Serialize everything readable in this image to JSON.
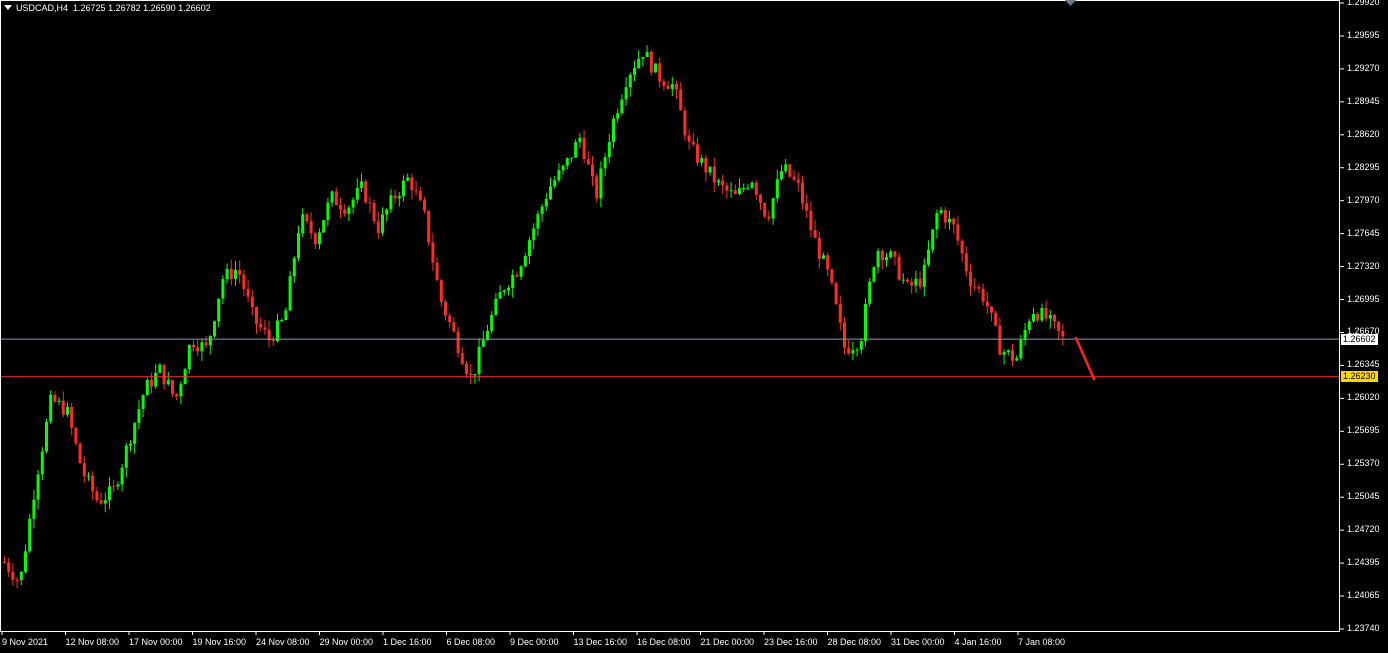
{
  "header": {
    "symbol_label": "USDCAD,H4",
    "ohlc_text": "1.26725 1.26782 1.26590 1.26602"
  },
  "colors": {
    "background": "#000000",
    "bull": "#00ff00",
    "bear": "#ff2a2a",
    "frame": "#ffffff",
    "current_price_line": "#8a9cb0",
    "support_line": "#ff3030",
    "support_tag": "#ffd700",
    "arrow": "#ff2020"
  },
  "chart_data": {
    "type": "candlestick",
    "title": "USDCAD,H4",
    "ylim": [
      1.2374,
      1.2992
    ],
    "y_ticks": [
      "1.29920",
      "1.29595",
      "1.29270",
      "1.28945",
      "1.28620",
      "1.28295",
      "1.27970",
      "1.27645",
      "1.27320",
      "1.26995",
      "1.26670",
      "1.26345",
      "1.26020",
      "1.25695",
      "1.25370",
      "1.25045",
      "1.24720",
      "1.24395",
      "1.24065",
      "1.23740"
    ],
    "x_ticks": [
      "9 Nov 2021",
      "12 Nov 08:00",
      "17 Nov 00:00",
      "19 Nov 16:00",
      "24 Nov 08:00",
      "29 Nov 00:00",
      "1 Dec 16:00",
      "6 Dec 08:00",
      "9 Dec 00:00",
      "13 Dec 16:00",
      "16 Dec 08:00",
      "21 Dec 00:00",
      "23 Dec 16:00",
      "28 Dec 08:00",
      "31 Dec 00:00",
      "4 Jan 16:00",
      "7 Jan 08:00"
    ],
    "current_price": "1.26602",
    "horizontal_level": "1.26230",
    "close_path": [
      1.244,
      1.242,
      1.252,
      1.26,
      1.259,
      1.253,
      1.25,
      1.251,
      1.256,
      1.261,
      1.263,
      1.26,
      1.266,
      1.265,
      1.272,
      1.273,
      1.268,
      1.266,
      1.268,
      1.278,
      1.276,
      1.28,
      1.279,
      1.281,
      1.277,
      1.28,
      1.282,
      1.278,
      1.27,
      1.266,
      1.262,
      1.267,
      1.271,
      1.273,
      1.277,
      1.281,
      1.283,
      1.286,
      1.28,
      1.287,
      1.292,
      1.2945,
      1.292,
      1.291,
      1.285,
      1.283,
      1.281,
      1.28,
      1.282,
      1.278,
      1.283,
      1.281,
      1.276,
      1.272,
      1.265,
      1.266,
      1.275,
      1.274,
      1.271,
      1.272,
      1.279,
      1.277,
      1.272,
      1.27,
      1.265,
      1.264,
      1.269,
      1.268,
      1.266
    ]
  }
}
